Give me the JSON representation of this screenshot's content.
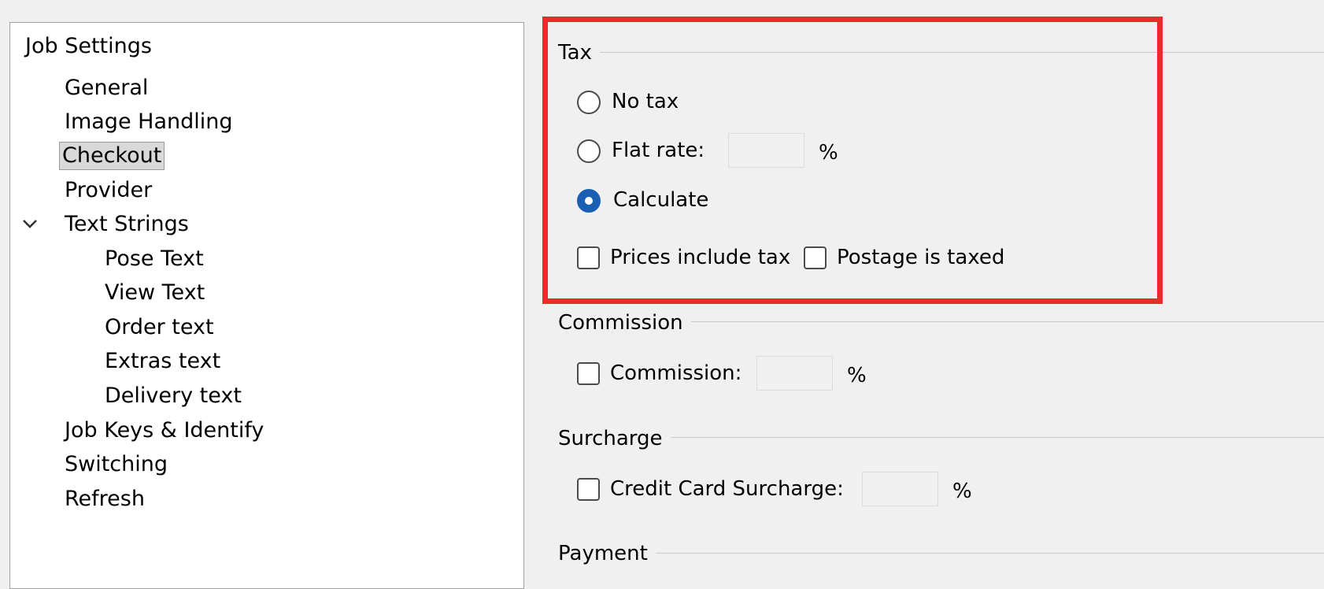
{
  "tree": {
    "root": "Job Settings",
    "items": [
      {
        "label": "General"
      },
      {
        "label": "Image Handling"
      },
      {
        "label": "Checkout"
      },
      {
        "label": "Provider"
      },
      {
        "label": "Text Strings"
      },
      {
        "label": "Pose Text"
      },
      {
        "label": "View Text"
      },
      {
        "label": "Order text"
      },
      {
        "label": "Extras text"
      },
      {
        "label": "Delivery text"
      },
      {
        "label": "Job Keys & Identify"
      },
      {
        "label": "Switching"
      },
      {
        "label": "Refresh"
      }
    ]
  },
  "tax": {
    "title": "Tax",
    "no_tax": "No tax",
    "flat_rate": "Flat rate:",
    "flat_rate_value": "",
    "percent": "%",
    "calculate": "Calculate",
    "prices_include_tax": "Prices include tax",
    "postage_is_taxed": "Postage is taxed",
    "selected": "Calculate"
  },
  "commission": {
    "title": "Commission",
    "label": "Commission:",
    "value": "",
    "percent": "%"
  },
  "surcharge": {
    "title": "Surcharge",
    "label": "Credit Card Surcharge:",
    "value": "",
    "percent": "%"
  },
  "payment": {
    "title": "Payment"
  },
  "colors": {
    "highlight": "#ee2b2b",
    "radio_selected": "#1a5fb4"
  }
}
